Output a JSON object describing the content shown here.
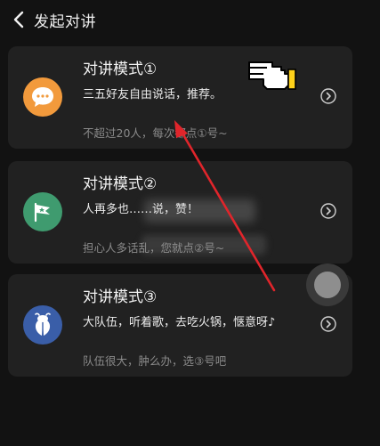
{
  "header": {
    "title": "发起对讲"
  },
  "modes": [
    {
      "name": "对讲模式①",
      "desc": "三五好友自由说话，推荐。",
      "note": "不超过20人，每次都点①号~",
      "color": "#f29a3c",
      "icon": "chat-bubble-icon"
    },
    {
      "name": "对讲模式②",
      "desc": "人再多也……说，赞！",
      "note": "担心人多话乱，您就点②号~",
      "color": "#3f9b6f",
      "icon": "flag-icon"
    },
    {
      "name": "对讲模式③",
      "desc": "大队伍，听着歌，去吃火锅，惬意呀♪",
      "note": "队伍很大，肿么办，选③号吧",
      "color": "#3a5ea8",
      "icon": "cicada-icon"
    }
  ]
}
